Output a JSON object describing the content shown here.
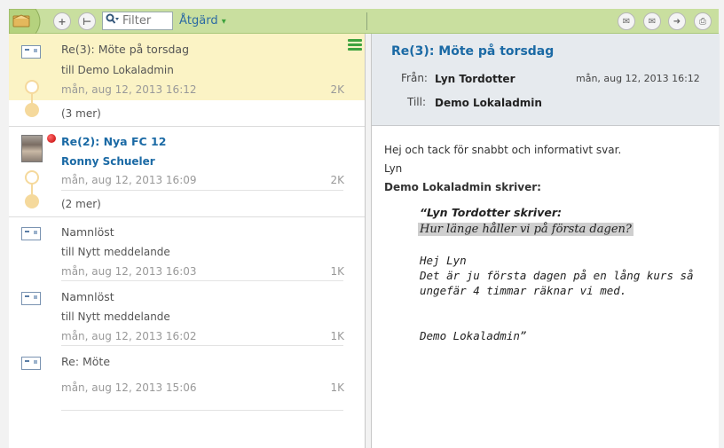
{
  "toolbar": {
    "filter_placeholder": "Filter",
    "action_label": "Åtgärd",
    "action_arrow": "▾",
    "icons": [
      "folder-icon",
      "add-icon",
      "tree-icon",
      "search-icon",
      "reply-all-icon",
      "forward-icon",
      "move-icon",
      "print-icon"
    ]
  },
  "list": {
    "items": [
      {
        "subject": "Re(3): Möte på torsdag",
        "to": "till Demo Lokaladmin",
        "date": "mån, aug 12, 2013 16:12",
        "size": "2K",
        "more": "(3 mer)"
      },
      {
        "subject": "Re(2): Nya FC 12",
        "from": "Ronny Schueler",
        "date": "mån, aug 12, 2013 16:09",
        "size": "2K",
        "more": "(2 mer)"
      },
      {
        "subject": "Namnlöst",
        "to": "till Nytt meddelande",
        "date": "mån, aug 12, 2013 16:03",
        "size": "1K"
      },
      {
        "subject": "Namnlöst",
        "to": "till Nytt meddelande",
        "date": "mån, aug 12, 2013 16:02",
        "size": "1K"
      },
      {
        "subject": "Re: Möte",
        "date": "mån, aug 12, 2013 15:06",
        "size": "1K"
      }
    ]
  },
  "reader": {
    "title": "Re(3): Möte på torsdag",
    "from_label": "Från:",
    "from_value": "Lyn Tordotter",
    "date": "mån, aug 12, 2013 16:12",
    "to_label": "Till:",
    "to_value": "Demo Lokaladmin",
    "body": {
      "line1": "Hej och tack för snabbt och informativt svar.",
      "line2": "Lyn",
      "line3": "Demo Lokaladmin skriver:",
      "quote_header": "“Lyn Tordotter skriver:",
      "quote_highlight": "Hur länge håller vi på första dagen?",
      "quote_greeting": "Hej Lyn",
      "quote_line1": "Det är ju första dagen på en lång kurs så",
      "quote_line2": "ungefär 4 timmar räknar vi med.",
      "quote_sign": "Demo Lokaladmin”"
    }
  }
}
